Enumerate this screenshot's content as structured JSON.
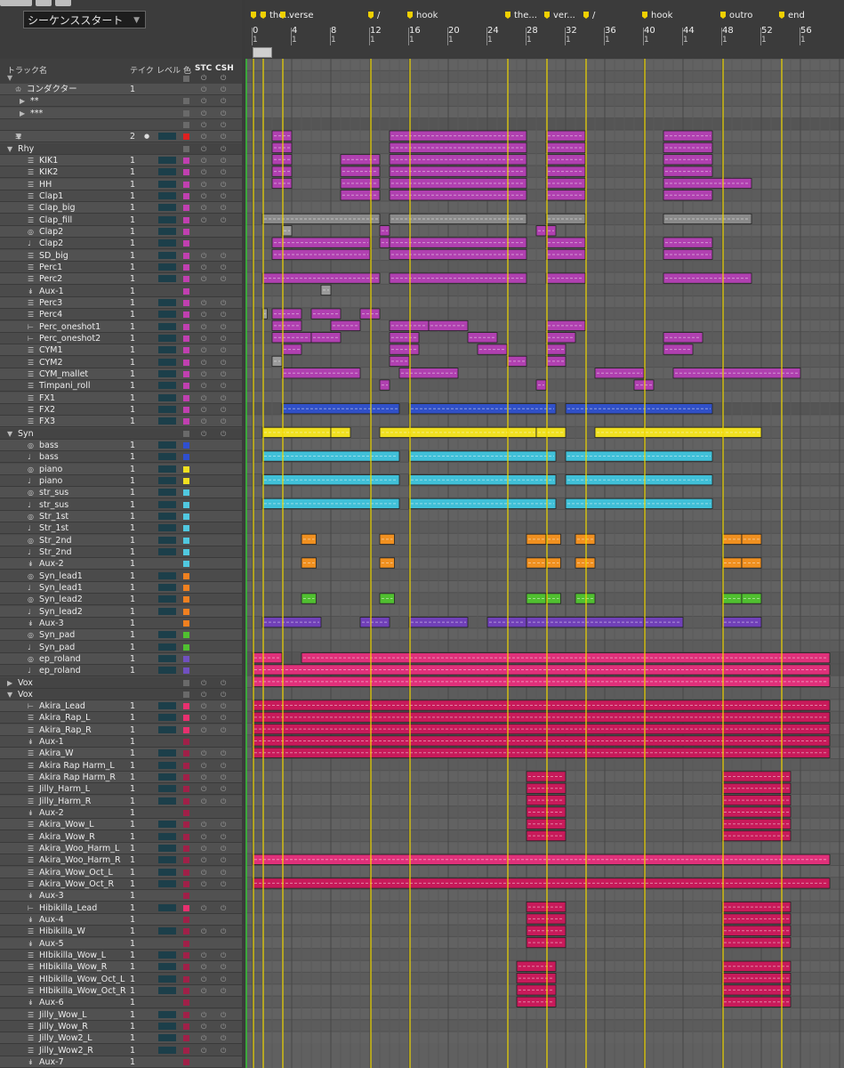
{
  "sequence_start": "シーケンススタート",
  "columns": {
    "track_name": "トラック名",
    "take": "テイク",
    "level": "レベル",
    "color": "色",
    "stc": "STC",
    "csh": "CSH"
  },
  "markers": [
    {
      "label": "0",
      "bar": 1
    },
    {
      "label": "the...",
      "bar": 2
    },
    {
      "label": "verse",
      "bar": 4
    },
    {
      "label": "/",
      "bar": 13
    },
    {
      "label": "hook",
      "bar": 17
    },
    {
      "label": "the...",
      "bar": 27
    },
    {
      "label": "ver...",
      "bar": 31
    },
    {
      "label": "/",
      "bar": 35
    },
    {
      "label": "hook",
      "bar": 41
    },
    {
      "label": "outro",
      "bar": 49
    },
    {
      "label": "end",
      "bar": 55
    }
  ],
  "bars": [
    "0",
    "4",
    "8",
    "12",
    "16",
    "20",
    "24",
    "28",
    "32",
    "36",
    "40",
    "44",
    "48",
    "52",
    "56"
  ],
  "bar_sub": "1",
  "groups": [
    "Rhy",
    "Syn",
    "Vox"
  ],
  "tracks": [
    {
      "name": "コンダクター",
      "take": "1",
      "type": "cond"
    },
    {
      "name": "**",
      "type": "sub"
    },
    {
      "name": "***",
      "type": "sub"
    },
    {
      "name": "",
      "type": "blank"
    },
    {
      "name": "",
      "take": "2",
      "type": "master",
      "color": "#e02020"
    },
    {
      "name": "Rhy",
      "type": "group"
    },
    {
      "name": "KIK1",
      "take": "1",
      "color": "#c040b0",
      "icon": "audio"
    },
    {
      "name": "KIK2",
      "take": "1",
      "color": "#c040b0",
      "icon": "audio"
    },
    {
      "name": "HH",
      "take": "1",
      "color": "#c040b0",
      "icon": "audio"
    },
    {
      "name": "Clap1",
      "take": "1",
      "color": "#c040b0",
      "icon": "audio"
    },
    {
      "name": "Clap_big",
      "take": "1",
      "color": "#c040b0",
      "icon": "audio"
    },
    {
      "name": "Clap_fill",
      "take": "1",
      "color": "#c040b0",
      "icon": "audio"
    },
    {
      "name": "Clap2",
      "take": "1",
      "color": "#c040b0",
      "icon": "inst"
    },
    {
      "name": "Clap2",
      "take": "1",
      "color": "#c040b0",
      "icon": "midi"
    },
    {
      "name": "SD_big",
      "take": "1",
      "color": "#c040b0",
      "icon": "audio"
    },
    {
      "name": "Perc1",
      "take": "1",
      "color": "#c040b0",
      "icon": "audio"
    },
    {
      "name": "Perc2",
      "take": "1",
      "color": "#c040b0",
      "icon": "audio"
    },
    {
      "name": "Aux-1",
      "take": "1",
      "color": "#c040b0",
      "icon": "aux"
    },
    {
      "name": "Perc3",
      "take": "1",
      "color": "#c040b0",
      "icon": "audio"
    },
    {
      "name": "Perc4",
      "take": "1",
      "color": "#c040b0",
      "icon": "audio"
    },
    {
      "name": "Perc_oneshot1",
      "take": "1",
      "color": "#c040b0",
      "icon": "mono"
    },
    {
      "name": "Perc_oneshot2",
      "take": "1",
      "color": "#c040b0",
      "icon": "mono"
    },
    {
      "name": "CYM1",
      "take": "1",
      "color": "#c040b0",
      "icon": "audio"
    },
    {
      "name": "CYM2",
      "take": "1",
      "color": "#c040b0",
      "icon": "audio"
    },
    {
      "name": "CYM_mallet",
      "take": "1",
      "color": "#c040b0",
      "icon": "audio"
    },
    {
      "name": "Timpani_roll",
      "take": "1",
      "color": "#c040b0",
      "icon": "audio"
    },
    {
      "name": "FX1",
      "take": "1",
      "color": "#c040b0",
      "icon": "audio"
    },
    {
      "name": "FX2",
      "take": "1",
      "color": "#c040b0",
      "icon": "audio"
    },
    {
      "name": "FX3",
      "take": "1",
      "color": "#c040b0",
      "icon": "audio"
    },
    {
      "name": "Syn",
      "type": "group"
    },
    {
      "name": "bass",
      "take": "1",
      "color": "#2f4fd0",
      "icon": "inst"
    },
    {
      "name": "bass",
      "take": "1",
      "color": "#2f4fd0",
      "icon": "midi"
    },
    {
      "name": "piano",
      "take": "1",
      "color": "#f0e020",
      "icon": "inst"
    },
    {
      "name": "piano",
      "take": "1",
      "color": "#f0e020",
      "icon": "midi"
    },
    {
      "name": "str_sus",
      "take": "1",
      "color": "#50c8e0",
      "icon": "inst"
    },
    {
      "name": "str_sus",
      "take": "1",
      "color": "#50c8e0",
      "icon": "midi"
    },
    {
      "name": "Str_1st",
      "take": "1",
      "color": "#50c8e0",
      "icon": "inst"
    },
    {
      "name": "Str_1st",
      "take": "1",
      "color": "#50c8e0",
      "icon": "midi"
    },
    {
      "name": "Str_2nd",
      "take": "1",
      "color": "#50c8e0",
      "icon": "inst"
    },
    {
      "name": "Str_2nd",
      "take": "1",
      "color": "#50c8e0",
      "icon": "midi"
    },
    {
      "name": "Aux-2",
      "take": "1",
      "color": "#50c8e0",
      "icon": "aux"
    },
    {
      "name": "Syn_lead1",
      "take": "1",
      "color": "#f08020",
      "icon": "inst"
    },
    {
      "name": "Syn_lead1",
      "take": "1",
      "color": "#f08020",
      "icon": "midi"
    },
    {
      "name": "Syn_lead2",
      "take": "1",
      "color": "#f08020",
      "icon": "inst"
    },
    {
      "name": "Syn_lead2",
      "take": "1",
      "color": "#f08020",
      "icon": "midi"
    },
    {
      "name": "Aux-3",
      "take": "1",
      "color": "#f08020",
      "icon": "aux"
    },
    {
      "name": "Syn_pad",
      "take": "1",
      "color": "#50c030",
      "icon": "inst"
    },
    {
      "name": "Syn_pad",
      "take": "1",
      "color": "#50c030",
      "icon": "midi"
    },
    {
      "name": "ep_roland",
      "take": "1",
      "color": "#7050c0",
      "icon": "inst"
    },
    {
      "name": "ep_roland",
      "take": "1",
      "color": "#7050c0",
      "icon": "midi"
    },
    {
      "name": "Vox",
      "type": "groupc"
    },
    {
      "name": "Vox",
      "type": "group"
    },
    {
      "name": "Akira_Lead",
      "take": "1",
      "color": "#e8306f",
      "icon": "mono"
    },
    {
      "name": "Akira_Rap_L",
      "take": "1",
      "color": "#e8306f",
      "icon": "audio"
    },
    {
      "name": "Akira_Rap_R",
      "take": "1",
      "color": "#e8306f",
      "icon": "audio"
    },
    {
      "name": "Aux-1",
      "take": "1",
      "color": "#a02048",
      "icon": "aux"
    },
    {
      "name": "Akira_W",
      "take": "1",
      "color": "#a02048",
      "icon": "audio"
    },
    {
      "name": "Akira Rap Harm_L",
      "take": "1",
      "color": "#a02048",
      "icon": "audio"
    },
    {
      "name": "Akira Rap Harm_R",
      "take": "1",
      "color": "#a02048",
      "icon": "audio"
    },
    {
      "name": "Jilly_Harm_L",
      "take": "1",
      "color": "#a02048",
      "icon": "audio"
    },
    {
      "name": "Jilly_Harm_R",
      "take": "1",
      "color": "#a02048",
      "icon": "audio"
    },
    {
      "name": "Aux-2",
      "take": "1",
      "color": "#a02048",
      "icon": "aux"
    },
    {
      "name": "Akira_Wow_L",
      "take": "1",
      "color": "#a02048",
      "icon": "audio"
    },
    {
      "name": "Akira_Wow_R",
      "take": "1",
      "color": "#a02048",
      "icon": "audio"
    },
    {
      "name": "Akira_Woo_Harm_L",
      "take": "1",
      "color": "#a02048",
      "icon": "audio"
    },
    {
      "name": "Akira_Woo_Harm_R",
      "take": "1",
      "color": "#a02048",
      "icon": "audio"
    },
    {
      "name": "Akira_Wow_Oct_L",
      "take": "1",
      "color": "#a02048",
      "icon": "audio"
    },
    {
      "name": "Akira_Wow_Oct_R",
      "take": "1",
      "color": "#a02048",
      "icon": "audio"
    },
    {
      "name": "Aux-3",
      "take": "1",
      "color": "#a02048",
      "icon": "aux"
    },
    {
      "name": "Hibikilla_Lead",
      "take": "1",
      "color": "#e8306f",
      "icon": "mono"
    },
    {
      "name": "Aux-4",
      "take": "1",
      "color": "#a02048",
      "icon": "aux"
    },
    {
      "name": "Hibikilla_W",
      "take": "1",
      "color": "#a02048",
      "icon": "audio"
    },
    {
      "name": "Aux-5",
      "take": "1",
      "color": "#a02048",
      "icon": "aux"
    },
    {
      "name": "HIbikilla_Wow_L",
      "take": "1",
      "color": "#a02048",
      "icon": "audio"
    },
    {
      "name": "HIbikilla_Wow_R",
      "take": "1",
      "color": "#a02048",
      "icon": "audio"
    },
    {
      "name": "HIbikilla_Wow_Oct_L",
      "take": "1",
      "color": "#a02048",
      "icon": "audio"
    },
    {
      "name": "HIbikilla_Wow_Oct_R",
      "take": "1",
      "color": "#a02048",
      "icon": "audio"
    },
    {
      "name": "Aux-6",
      "take": "1",
      "color": "#a02048",
      "icon": "aux"
    },
    {
      "name": "Jilly_Wow_L",
      "take": "1",
      "color": "#a02048",
      "icon": "audio"
    },
    {
      "name": "Jilly_Wow_R",
      "take": "1",
      "color": "#a02048",
      "icon": "audio"
    },
    {
      "name": "Jilly_Wow2_L",
      "take": "1",
      "color": "#a02048",
      "icon": "audio"
    },
    {
      "name": "Jilly_Wow2_R",
      "take": "1",
      "color": "#a02048",
      "icon": "audio"
    },
    {
      "name": "Aux-7",
      "take": "1",
      "color": "#a02048",
      "icon": "aux"
    }
  ],
  "regions": [
    [
      6,
      2,
      4,
      "#b040b0"
    ],
    [
      6,
      14,
      28,
      "#b040b0"
    ],
    [
      6,
      30,
      34,
      "#b040b0"
    ],
    [
      6,
      42,
      47,
      "#b040b0"
    ],
    [
      7,
      2,
      4,
      "#b040b0"
    ],
    [
      7,
      14,
      28,
      "#b040b0"
    ],
    [
      7,
      30,
      34,
      "#b040b0"
    ],
    [
      7,
      42,
      47,
      "#b040b0"
    ],
    [
      8,
      2,
      4,
      "#b040b0"
    ],
    [
      8,
      9,
      13,
      "#b040b0"
    ],
    [
      8,
      14,
      28,
      "#b040b0"
    ],
    [
      8,
      30,
      34,
      "#b040b0"
    ],
    [
      8,
      42,
      47,
      "#b040b0"
    ],
    [
      9,
      2,
      4,
      "#b040b0"
    ],
    [
      9,
      9,
      13,
      "#b040b0"
    ],
    [
      9,
      14,
      28,
      "#b040b0"
    ],
    [
      9,
      30,
      34,
      "#b040b0"
    ],
    [
      9,
      42,
      47,
      "#b040b0"
    ],
    [
      10,
      2,
      4,
      "#b040b0"
    ],
    [
      10,
      9,
      13,
      "#b040b0"
    ],
    [
      10,
      14,
      28,
      "#b040b0"
    ],
    [
      10,
      30,
      34,
      "#b040b0"
    ],
    [
      10,
      42,
      51,
      "#b040b0"
    ],
    [
      11,
      9,
      13,
      "#b040b0"
    ],
    [
      11,
      14,
      28,
      "#b040b0"
    ],
    [
      11,
      30,
      34,
      "#b040b0"
    ],
    [
      11,
      42,
      47,
      "#b040b0"
    ],
    [
      13,
      1,
      13,
      "#8a8a8a"
    ],
    [
      13,
      14,
      28,
      "#8a8a8a"
    ],
    [
      13,
      30,
      34,
      "#8a8a8a"
    ],
    [
      13,
      42,
      51,
      "#8a8a8a"
    ],
    [
      14,
      3,
      4,
      "#9a9a9a"
    ],
    [
      14,
      13,
      14,
      "#b040b0"
    ],
    [
      14,
      29,
      30,
      "#b040b0"
    ],
    [
      14,
      30,
      31,
      "#b040b0"
    ],
    [
      15,
      2,
      12,
      "#b040b0"
    ],
    [
      15,
      13,
      14,
      "#b040b0"
    ],
    [
      15,
      14,
      28,
      "#b040b0"
    ],
    [
      15,
      30,
      34,
      "#b040b0"
    ],
    [
      15,
      42,
      47,
      "#b040b0"
    ],
    [
      16,
      2,
      12,
      "#b040b0"
    ],
    [
      16,
      14,
      28,
      "#b040b0"
    ],
    [
      16,
      30,
      34,
      "#b040b0"
    ],
    [
      16,
      42,
      47,
      "#b040b0"
    ],
    [
      18,
      1,
      13,
      "#b040b0"
    ],
    [
      18,
      14,
      28,
      "#b040b0"
    ],
    [
      18,
      30,
      34,
      "#b040b0"
    ],
    [
      18,
      42,
      51,
      "#b040b0"
    ],
    [
      19,
      7,
      8,
      "#9a9a9a"
    ],
    [
      21,
      1,
      1.5,
      "#9a9a9a"
    ],
    [
      21,
      2,
      5,
      "#b040b0"
    ],
    [
      21,
      6,
      9,
      "#b040b0"
    ],
    [
      21,
      11,
      13,
      "#b040b0"
    ],
    [
      22,
      2,
      5,
      "#b040b0"
    ],
    [
      22,
      8,
      11,
      "#b040b0"
    ],
    [
      22,
      14,
      18,
      "#b040b0"
    ],
    [
      22,
      18,
      22,
      "#b040b0"
    ],
    [
      22,
      30,
      34,
      "#b040b0"
    ],
    [
      23,
      2,
      6,
      "#b040b0"
    ],
    [
      23,
      6,
      9,
      "#b040b0"
    ],
    [
      23,
      14,
      17,
      "#b040b0"
    ],
    [
      23,
      22,
      25,
      "#b040b0"
    ],
    [
      23,
      30,
      33,
      "#b040b0"
    ],
    [
      23,
      42,
      46,
      "#b040b0"
    ],
    [
      24,
      3,
      5,
      "#b040b0"
    ],
    [
      24,
      14,
      17,
      "#b040b0"
    ],
    [
      24,
      23,
      26,
      "#b040b0"
    ],
    [
      24,
      30,
      32,
      "#b040b0"
    ],
    [
      24,
      42,
      45,
      "#b040b0"
    ],
    [
      25,
      2,
      3,
      "#9a9a9a"
    ],
    [
      25,
      14,
      16,
      "#b040b0"
    ],
    [
      25,
      26,
      28,
      "#b040b0"
    ],
    [
      25,
      30,
      32,
      "#b040b0"
    ],
    [
      26,
      3,
      11,
      "#b040b0"
    ],
    [
      26,
      15,
      21,
      "#b040b0"
    ],
    [
      26,
      35,
      40,
      "#b040b0"
    ],
    [
      26,
      43,
      56,
      "#b040b0"
    ],
    [
      27,
      13,
      14,
      "#b040b0"
    ],
    [
      27,
      29,
      30,
      "#b040b0"
    ],
    [
      27,
      39,
      41,
      "#b040b0"
    ],
    [
      29,
      3,
      15,
      "#3050c8"
    ],
    [
      29,
      16,
      31,
      "#3050c8"
    ],
    [
      29,
      32,
      47,
      "#3050c8"
    ],
    [
      31,
      1,
      8,
      "#f0e020"
    ],
    [
      31,
      8,
      10,
      "#f0e020"
    ],
    [
      31,
      13,
      29,
      "#f0e020"
    ],
    [
      31,
      29,
      32,
      "#f0e020"
    ],
    [
      31,
      35,
      52,
      "#f0e020"
    ],
    [
      33,
      1,
      15,
      "#40c0d8"
    ],
    [
      33,
      16,
      31,
      "#40c0d8"
    ],
    [
      33,
      32,
      47,
      "#40c0d8"
    ],
    [
      35,
      1,
      15,
      "#40c0d8"
    ],
    [
      35,
      16,
      31,
      "#40c0d8"
    ],
    [
      35,
      32,
      47,
      "#40c0d8"
    ],
    [
      37,
      1,
      15,
      "#40c0d8"
    ],
    [
      37,
      16,
      31,
      "#40c0d8"
    ],
    [
      37,
      32,
      47,
      "#40c0d8"
    ],
    [
      40,
      5,
      6.5,
      "#f09020"
    ],
    [
      40,
      13,
      14.5,
      "#f09020"
    ],
    [
      40,
      28,
      30,
      "#f09020"
    ],
    [
      40,
      30,
      31.5,
      "#f09020"
    ],
    [
      40,
      33,
      35,
      "#f09020"
    ],
    [
      40,
      48,
      50,
      "#f09020"
    ],
    [
      40,
      50,
      52,
      "#f09020"
    ],
    [
      42,
      5,
      6.5,
      "#f09020"
    ],
    [
      42,
      13,
      14.5,
      "#f09020"
    ],
    [
      42,
      28,
      30,
      "#f09020"
    ],
    [
      42,
      30,
      31.5,
      "#f09020"
    ],
    [
      42,
      33,
      35,
      "#f09020"
    ],
    [
      42,
      48,
      50,
      "#f09020"
    ],
    [
      42,
      50,
      52,
      "#f09020"
    ],
    [
      45,
      5,
      6.5,
      "#50c030"
    ],
    [
      45,
      13,
      14.5,
      "#50c030"
    ],
    [
      45,
      28,
      30,
      "#50c030"
    ],
    [
      45,
      30,
      31.5,
      "#50c030"
    ],
    [
      45,
      33,
      35,
      "#50c030"
    ],
    [
      45,
      48,
      50,
      "#50c030"
    ],
    [
      45,
      50,
      52,
      "#50c030"
    ],
    [
      47,
      1,
      7,
      "#7040b8"
    ],
    [
      47,
      11,
      14,
      "#7040b8"
    ],
    [
      47,
      16,
      22,
      "#7040b8"
    ],
    [
      47,
      24,
      28,
      "#7040b8"
    ],
    [
      47,
      28,
      40,
      "#7040b8"
    ],
    [
      47,
      40,
      44,
      "#7040b8"
    ],
    [
      47,
      48,
      52,
      "#7040b8"
    ],
    [
      50,
      0,
      3,
      "#e0307a"
    ],
    [
      50,
      5,
      59,
      "#e0307a"
    ],
    [
      51,
      0,
      59,
      "#e0307a"
    ],
    [
      52,
      0,
      59,
      "#e0307a"
    ],
    [
      54,
      0,
      59,
      "#c81a5a"
    ],
    [
      55,
      0,
      59,
      "#c81a5a"
    ],
    [
      56,
      0,
      59,
      "#c81a5a"
    ],
    [
      57,
      0,
      59,
      "#c81a5a"
    ],
    [
      58,
      0,
      59,
      "#c81a5a"
    ],
    [
      60,
      28,
      32,
      "#c81a5a"
    ],
    [
      61,
      28,
      32,
      "#c81a5a"
    ],
    [
      62,
      28,
      32,
      "#c81a5a"
    ],
    [
      63,
      28,
      32,
      "#c81a5a"
    ],
    [
      64,
      28,
      32,
      "#c81a5a"
    ],
    [
      65,
      28,
      32,
      "#c81a5a"
    ],
    [
      60,
      48,
      55,
      "#c81a5a"
    ],
    [
      61,
      48,
      55,
      "#c81a5a"
    ],
    [
      62,
      48,
      55,
      "#c81a5a"
    ],
    [
      63,
      48,
      55,
      "#c81a5a"
    ],
    [
      64,
      48,
      55,
      "#c81a5a"
    ],
    [
      65,
      48,
      55,
      "#c81a5a"
    ],
    [
      67,
      0,
      59,
      "#e0307a"
    ],
    [
      69,
      0,
      59,
      "#c81a5a"
    ],
    [
      71,
      28,
      32,
      "#c81a5a"
    ],
    [
      72,
      28,
      32,
      "#c81a5a"
    ],
    [
      73,
      28,
      32,
      "#c81a5a"
    ],
    [
      74,
      28,
      32,
      "#c81a5a"
    ],
    [
      71,
      48,
      55,
      "#c81a5a"
    ],
    [
      72,
      48,
      55,
      "#c81a5a"
    ],
    [
      73,
      48,
      55,
      "#c81a5a"
    ],
    [
      74,
      48,
      55,
      "#c81a5a"
    ],
    [
      76,
      27,
      31,
      "#c81a5a"
    ],
    [
      77,
      27,
      31,
      "#c81a5a"
    ],
    [
      78,
      27,
      31,
      "#c81a5a"
    ],
    [
      79,
      27,
      31,
      "#c81a5a"
    ],
    [
      76,
      48,
      55,
      "#c81a5a"
    ],
    [
      77,
      48,
      55,
      "#c81a5a"
    ],
    [
      78,
      48,
      55,
      "#c81a5a"
    ],
    [
      79,
      48,
      55,
      "#c81a5a"
    ]
  ],
  "icon_names": {
    "audio": "audio-track-icon",
    "inst": "instrument-track-icon",
    "midi": "midi-track-icon",
    "mono": "mono-audio-track-icon",
    "aux": "aux-track-icon",
    "cond": "conductor-icon"
  }
}
